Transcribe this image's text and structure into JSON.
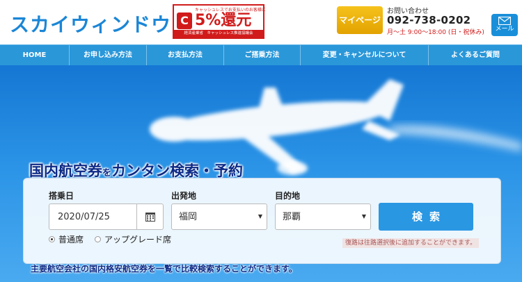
{
  "header": {
    "logo": "スカイウィンドウ",
    "cashless": {
      "top_text": "キャッシュレスでお支払いのお客様に",
      "mark": "C",
      "main": "5%還元",
      "bottom_text": "経済産業省　キャッシュレス推進協議会"
    },
    "mypage_label": "マイページ",
    "contact_label": "お問い合わせ",
    "phone": "092-738-0202",
    "hours": "月〜土 9:00〜18:00 (日・祝休み)",
    "mail_label": "メール"
  },
  "nav": {
    "items": [
      {
        "label": "HOME"
      },
      {
        "label": "お申し込み方法"
      },
      {
        "label": "お支払方法"
      },
      {
        "label": "ご搭乗方法"
      },
      {
        "label": "変更・キャンセルについて"
      },
      {
        "label": "よくあるご質問"
      }
    ]
  },
  "hero": {
    "headline_a": "国内航空券",
    "headline_b": "を",
    "headline_c": "カンタン検索・予約"
  },
  "search": {
    "date_label": "搭乗日",
    "date_value": "2020/07/25",
    "origin_label": "出発地",
    "origin_value": "福岡",
    "dest_label": "目的地",
    "dest_value": "那覇",
    "search_button": "検索",
    "seat_normal": "普通席",
    "seat_upgrade": "アップグレード席",
    "return_note": "復路は往路選択後に追加することができます。"
  },
  "footer_text": "主要航空会社の国内格安航空券を一覧で比較検索することができます。",
  "colors": {
    "brand_blue": "#1b86d6",
    "nav_blue": "#2a97d9",
    "accent_yellow": "#f6c21c",
    "alert_red": "#d11b1b"
  }
}
